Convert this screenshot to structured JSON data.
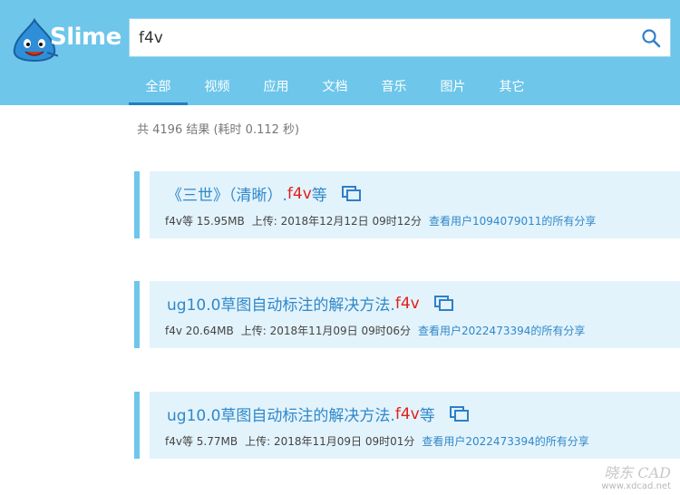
{
  "app": {
    "logo_text": "Slime"
  },
  "search": {
    "value": "f4v"
  },
  "tabs": [
    {
      "label": "全部",
      "active": true
    },
    {
      "label": "视频"
    },
    {
      "label": "应用"
    },
    {
      "label": "文档"
    },
    {
      "label": "音乐"
    },
    {
      "label": "图片"
    },
    {
      "label": "其它"
    }
  ],
  "stats": "共 4196 结果 (耗时 0.112 秒)",
  "results": [
    {
      "title_main": "《三世》（清晰）.",
      "title_hl": "f4v",
      "title_tail": "等",
      "size": "f4v等 15.95MB",
      "upload": "上传: 2018年12月12日 09时12分",
      "user_link": "查看用户1094079011的所有分享"
    },
    {
      "title_main": "ug10.0草图自动标注的解决方法.",
      "title_hl": "f4v",
      "title_tail": "",
      "size": "f4v 20.64MB",
      "upload": "上传: 2018年11月09日 09时06分",
      "user_link": "查看用户2022473394的所有分享"
    },
    {
      "title_main": "ug10.0草图自动标注的解决方法.",
      "title_hl": "f4v",
      "title_tail": "等",
      "size": "f4v等 5.77MB",
      "upload": "上传: 2018年11月09日 09时01分",
      "user_link": "查看用户2022473394的所有分享"
    }
  ],
  "watermark": {
    "brand": "晓东 CAD",
    "url": "www.xdcad.net"
  },
  "colors": {
    "header": "#6ec6ea",
    "link": "#2f88c8",
    "highlight": "#e0201b",
    "result_bg": "#e3f3fc"
  },
  "icons": {
    "search": "search-icon",
    "copy": "copy-icon",
    "logo": "slime-logo-icon"
  }
}
